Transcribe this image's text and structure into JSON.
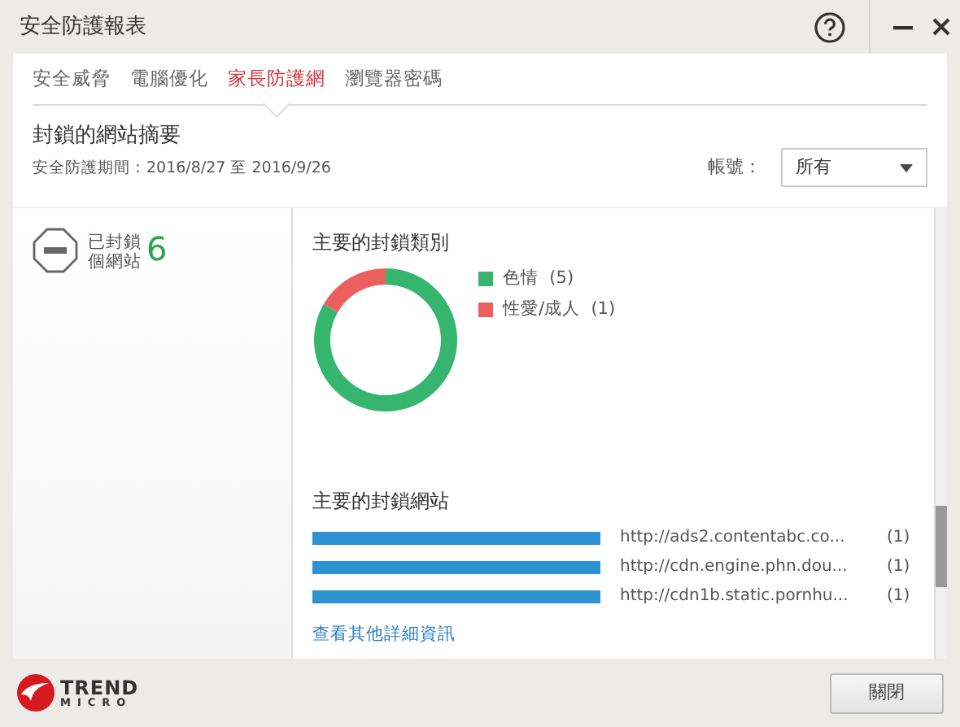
{
  "window": {
    "title": "安全防護報表"
  },
  "tabs": [
    {
      "label": "安全威脅",
      "selected": false
    },
    {
      "label": "電腦優化",
      "selected": false
    },
    {
      "label": "家長防護網",
      "selected": true
    },
    {
      "label": "瀏覽器密碼",
      "selected": false
    }
  ],
  "header": {
    "title": "封鎖的網站摘要",
    "period": "安全防護期間：2016/8/27 至 2016/9/26",
    "account_label": "帳號：",
    "account_value": "所有"
  },
  "summary": {
    "label_line1": "已封鎖",
    "label_line2": "個網站",
    "count": "6"
  },
  "categories": {
    "title": "主要的封鎖類別",
    "chart_data": {
      "type": "donut",
      "categories": [
        "色情",
        "性愛/成人"
      ],
      "values": [
        83.33,
        16.67
      ]
    },
    "legend": [
      {
        "count": "(5)",
        "color": "#36b56f"
      },
      {
        "count": "(1)",
        "color": "#ec5f5f"
      }
    ]
  },
  "sites": {
    "title": "主要的封鎖網站",
    "items": [
      {
        "url": "http://ads2.contentabc.co...",
        "count": "(1)"
      },
      {
        "url": "http://cdn.engine.phn.dou...",
        "count": "(1)"
      },
      {
        "url": "http://cdn1b.static.pornhu...",
        "count": "(1)"
      }
    ],
    "more_link": "查看其他詳細資訊"
  },
  "footer": {
    "logo_line1": "TREND",
    "logo_line2": "MICRO",
    "close_button": "關閉"
  }
}
